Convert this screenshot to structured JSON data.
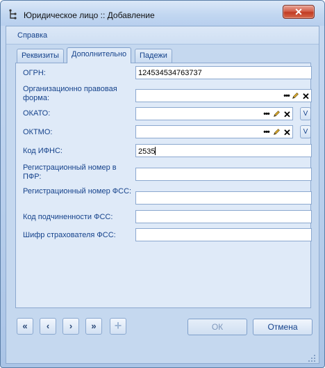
{
  "window": {
    "title": "Юридическое лицо :: Добавление",
    "close_label": "✕"
  },
  "menu": {
    "help_label": "Справка"
  },
  "tabs": [
    {
      "label": "Реквизиты",
      "active": false
    },
    {
      "label": "Дополнительно",
      "active": true
    },
    {
      "label": "Падежи",
      "active": false
    }
  ],
  "fields": {
    "ogrn": {
      "label": "ОГРН:",
      "value": "124534534763737"
    },
    "org_form": {
      "label": "Организационно правовая форма:",
      "value": ""
    },
    "okato": {
      "label": "ОКАТО:",
      "value": "",
      "v_label": "V"
    },
    "oktmo": {
      "label": "ОКТМО:",
      "value": "",
      "v_label": "V"
    },
    "kod_ifns": {
      "label": "Код ИФНС:",
      "value": "2535"
    },
    "reg_pfr": {
      "label": "Регистрационный номер в ПФР:",
      "value": ""
    },
    "reg_fss": {
      "label": "Регистрационный номер ФСС:",
      "value": ""
    },
    "kod_fss": {
      "label": "Код подчиненности ФСС:",
      "value": ""
    },
    "shifr_fss": {
      "label": "Шифр страхователя ФСС:",
      "value": ""
    }
  },
  "lookup_buttons": {
    "dots": "•••",
    "clear": "✕"
  },
  "nav": {
    "first": "«",
    "prev": "‹",
    "next": "›",
    "last": "»",
    "add": "+"
  },
  "dialog_buttons": {
    "ok": "ОК",
    "cancel": "Отмена"
  },
  "icons": {
    "app": "hierarchy-icon",
    "dots": "ellipsis-icon",
    "pick": "pencil-icon",
    "clear": "close-icon",
    "add": "plus-icon",
    "grip": "resize-grip-icon"
  }
}
